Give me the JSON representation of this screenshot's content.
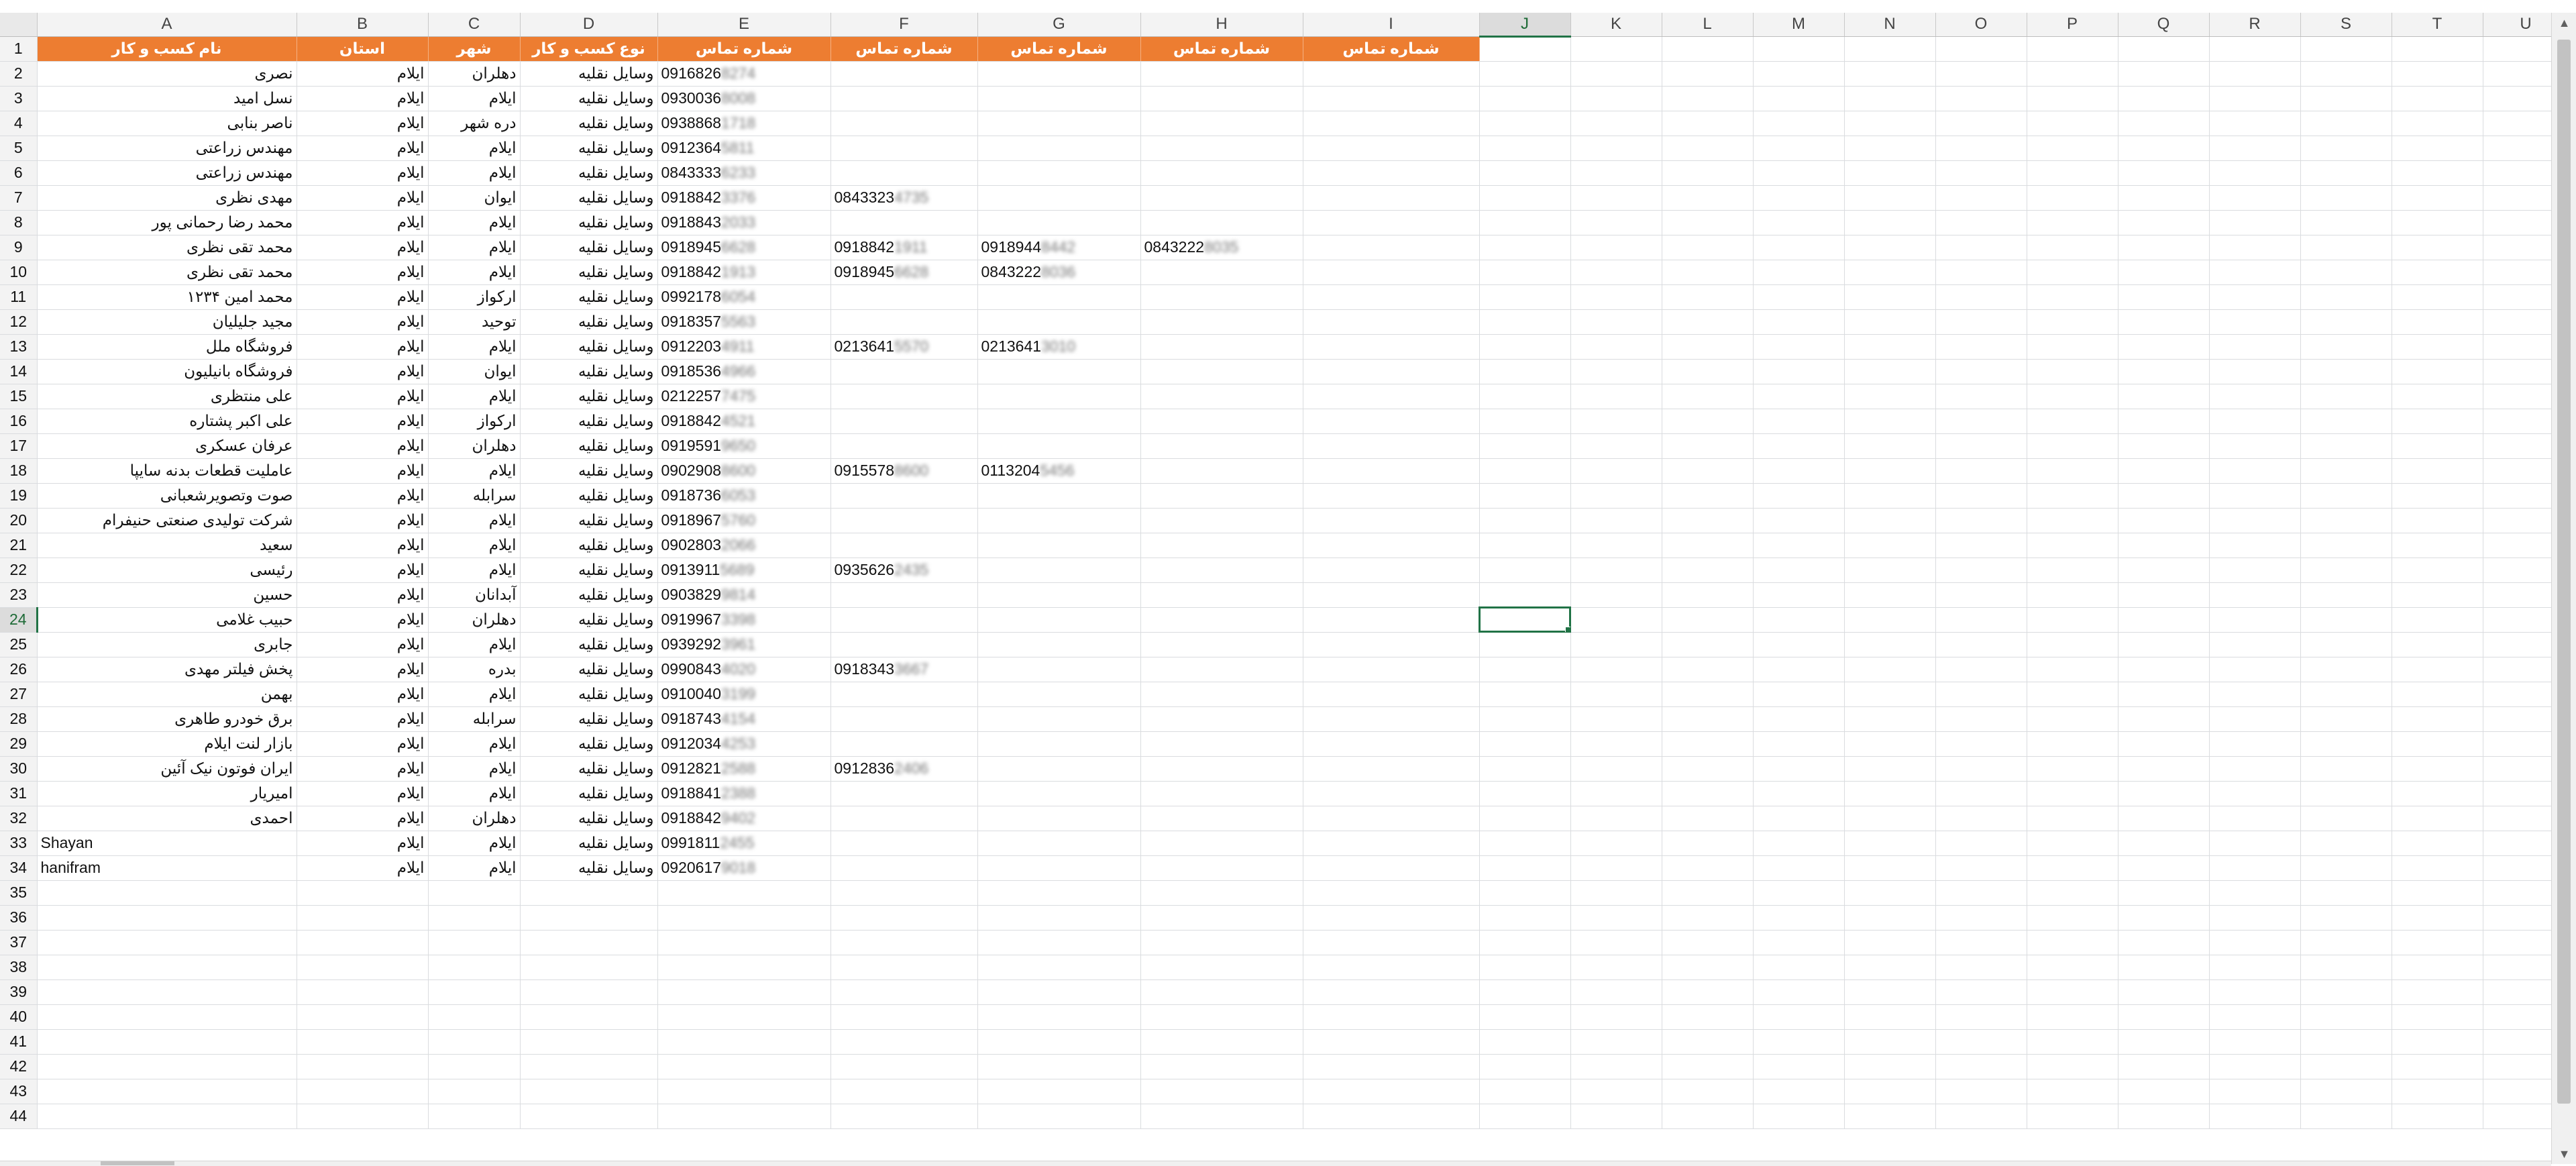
{
  "sheet": {
    "columns": [
      "A",
      "B",
      "C",
      "D",
      "E",
      "F",
      "G",
      "H",
      "I",
      "J",
      "K",
      "L",
      "M",
      "N",
      "O",
      "P",
      "Q",
      "R",
      "S",
      "T",
      "U"
    ],
    "active_column": "J",
    "active_row": 24,
    "total_rows": 44,
    "header_row": {
      "A": "نام کسب و کار",
      "B": "استان",
      "C": "شهر",
      "D": "نوع کسب و کار",
      "E": "شماره تماس",
      "F": "شماره تماس",
      "G": "شماره تماس",
      "H": "شماره تماس",
      "I": "شماره تماس"
    },
    "rows": [
      {
        "A": "نصری",
        "B": "ایلام",
        "C": "دهلران",
        "D": "وسایل نقلیه",
        "E": [
          "0916826",
          "8274"
        ]
      },
      {
        "A": "نسل امید",
        "B": "ایلام",
        "C": "ایلام",
        "D": "وسایل نقلیه",
        "E": [
          "0930036",
          "8008"
        ]
      },
      {
        "A": "ناصر بنابی",
        "B": "ایلام",
        "C": "دره شهر",
        "D": "وسایل نقلیه",
        "E": [
          "0938868",
          "1718"
        ]
      },
      {
        "A": "مهندس زراعتی",
        "B": "ایلام",
        "C": "ایلام",
        "D": "وسایل نقلیه",
        "E": [
          "0912364",
          "5811"
        ]
      },
      {
        "A": "مهندس زراعتی",
        "B": "ایلام",
        "C": "ایلام",
        "D": "وسایل نقلیه",
        "E": [
          "0843333",
          "6233"
        ]
      },
      {
        "A": "مهدی نظری",
        "B": "ایلام",
        "C": "ایوان",
        "D": "وسایل نقلیه",
        "E": [
          "0918842",
          "3376"
        ],
        "F": [
          "0843323",
          "4735"
        ]
      },
      {
        "A": "محمد رضا رحمانی پور",
        "B": "ایلام",
        "C": "ایلام",
        "D": "وسایل نقلیه",
        "E": [
          "0918843",
          "2033"
        ]
      },
      {
        "A": "محمد تقی نظری",
        "B": "ایلام",
        "C": "ایلام",
        "D": "وسایل نقلیه",
        "E": [
          "0918945",
          "6628"
        ],
        "F": [
          "0918842",
          "1911"
        ],
        "G": [
          "0918944",
          "8442"
        ],
        "H": [
          "0843222",
          "8035"
        ]
      },
      {
        "A": "محمد تقی نظری",
        "B": "ایلام",
        "C": "ایلام",
        "D": "وسایل نقلیه",
        "E": [
          "0918842",
          "1913"
        ],
        "F": [
          "0918945",
          "6628"
        ],
        "G": [
          "0843222",
          "8036"
        ]
      },
      {
        "A": "محمد امین ۱۲۳۴",
        "B": "ایلام",
        "C": "ارکواز",
        "D": "وسایل نقلیه",
        "E": [
          "0992178",
          "6054"
        ]
      },
      {
        "A": "مجید جلیلیان",
        "B": "ایلام",
        "C": "توحید",
        "D": "وسایل نقلیه",
        "E": [
          "0918357",
          "5563"
        ]
      },
      {
        "A": "فروشگاه ملل",
        "B": "ایلام",
        "C": "ایلام",
        "D": "وسایل نقلیه",
        "E": [
          "0912203",
          "4911"
        ],
        "F": [
          "0213641",
          "5570"
        ],
        "G": [
          "0213641",
          "3010"
        ]
      },
      {
        "A": "فروشگاه بانیلیون",
        "B": "ایلام",
        "C": "ایوان",
        "D": "وسایل نقلیه",
        "E": [
          "0918536",
          "4966"
        ]
      },
      {
        "A": "علی منتظری",
        "B": "ایلام",
        "C": "ایلام",
        "D": "وسایل نقلیه",
        "E": [
          "0212257",
          "7475"
        ]
      },
      {
        "A": "علی اکبر پشتاره",
        "B": "ایلام",
        "C": "ارکواز",
        "D": "وسایل نقلیه",
        "E": [
          "0918842",
          "4521"
        ]
      },
      {
        "A": "عرفان عسکری",
        "B": "ایلام",
        "C": "دهلران",
        "D": "وسایل نقلیه",
        "E": [
          "0919591",
          "9650"
        ]
      },
      {
        "A": "عاملیت قطعات بدنه سایپا",
        "B": "ایلام",
        "C": "ایلام",
        "D": "وسایل نقلیه",
        "E": [
          "0902908",
          "8600"
        ],
        "F": [
          "0915578",
          "8600"
        ],
        "G": [
          "0113204",
          "5456"
        ]
      },
      {
        "A": "صوت وتصویرشعبانی",
        "B": "ایلام",
        "C": "سرابله",
        "D": "وسایل نقلیه",
        "E": [
          "0918736",
          "6053"
        ]
      },
      {
        "A": "شرکت تولیدی صنعتی حنیفرام",
        "B": "ایلام",
        "C": "ایلام",
        "D": "وسایل نقلیه",
        "E": [
          "0918967",
          "5760"
        ]
      },
      {
        "A": "سعید",
        "B": "ایلام",
        "C": "ایلام",
        "D": "وسایل نقلیه",
        "E": [
          "0902803",
          "2066"
        ]
      },
      {
        "A": "رئیسی",
        "B": "ایلام",
        "C": "ایلام",
        "D": "وسایل نقلیه",
        "E": [
          "0913911",
          "5689"
        ],
        "F": [
          "0935626",
          "2435"
        ]
      },
      {
        "A": "حسین",
        "B": "ایلام",
        "C": "آبدانان",
        "D": "وسایل نقلیه",
        "E": [
          "0903829",
          "9814"
        ]
      },
      {
        "A": "حبیب غلامی",
        "B": "ایلام",
        "C": "دهلران",
        "D": "وسایل نقلیه",
        "E": [
          "0919967",
          "3398"
        ]
      },
      {
        "A": "جابری",
        "B": "ایلام",
        "C": "ایلام",
        "D": "وسایل نقلیه",
        "E": [
          "0939292",
          "3961"
        ]
      },
      {
        "A": "پخش فیلتر مهدی",
        "B": "ایلام",
        "C": "بدره",
        "D": "وسایل نقلیه",
        "E": [
          "0990843",
          "4020"
        ],
        "F": [
          "0918343",
          "3667"
        ]
      },
      {
        "A": "بهمن",
        "B": "ایلام",
        "C": "ایلام",
        "D": "وسایل نقلیه",
        "E": [
          "0910040",
          "3199"
        ]
      },
      {
        "A": "برق خودرو طاهری",
        "B": "ایلام",
        "C": "سرابله",
        "D": "وسایل نقلیه",
        "E": [
          "0918743",
          "4154"
        ]
      },
      {
        "A": "بازار لنت ایلام",
        "B": "ایلام",
        "C": "ایلام",
        "D": "وسایل نقلیه",
        "E": [
          "0912034",
          "4253"
        ]
      },
      {
        "A": "ایران فوتون نیک آئین",
        "B": "ایلام",
        "C": "ایلام",
        "D": "وسایل نقلیه",
        "E": [
          "0912821",
          "2588"
        ],
        "F": [
          "0912836",
          "2406"
        ]
      },
      {
        "A": "امیریار",
        "B": "ایلام",
        "C": "ایلام",
        "D": "وسایل نقلیه",
        "E": [
          "0918841",
          "2388"
        ]
      },
      {
        "A": "احمدی",
        "B": "ایلام",
        "C": "دهلران",
        "D": "وسایل نقلیه",
        "E": [
          "0918842",
          "9402"
        ]
      },
      {
        "A": "Shayan",
        "B": "ایلام",
        "C": "ایلام",
        "D": "وسایل نقلیه",
        "E": [
          "0991811",
          "2455"
        ]
      },
      {
        "A": "hanifram",
        "B": "ایلام",
        "C": "ایلام",
        "D": "وسایل نقلیه",
        "E": [
          "0920617",
          "9018"
        ]
      }
    ]
  },
  "scrollbar": {
    "up_arrow": "▲",
    "down_arrow": "▼"
  }
}
